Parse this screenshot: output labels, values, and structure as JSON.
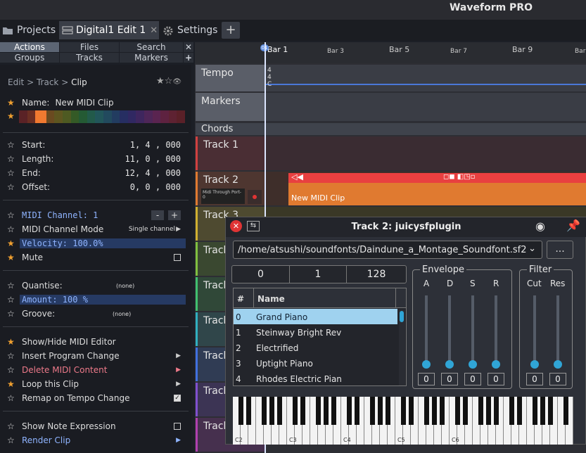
{
  "app": {
    "title": "Waveform PRO"
  },
  "tabs": [
    {
      "label": "Projects"
    },
    {
      "label": "Digital1 Edit 1"
    },
    {
      "label": "Settings"
    }
  ],
  "gridnav": {
    "actions": "Actions",
    "files": "Files",
    "search": "Search",
    "groups": "Groups",
    "tracks": "Tracks",
    "markers": "Markers"
  },
  "breadcrumb": {
    "a": "Edit",
    "b": "Track",
    "c": "Clip",
    "sep": ">"
  },
  "clip": {
    "name_label": "Name:",
    "name_value": "New MIDI Clip",
    "start_label": "Start:",
    "start_value": "1, 4 , 000",
    "length_label": "Length:",
    "length_value": "11, 0 , 000",
    "end_label": "End:",
    "end_value": "12, 4 , 000",
    "offset_label": "Offset:",
    "offset_value": "0, 0 , 000",
    "midi_channel": "MIDI Channel: 1",
    "midi_mode_label": "MIDI Channel Mode",
    "midi_mode_value": "Single channel",
    "velocity": "Velocity: 100.0%",
    "mute": "Mute",
    "quantise_label": "Quantise:",
    "quantise_value": "(none)",
    "amount": "Amount: 100 %",
    "groove_label": "Groove:",
    "groove_value": "(none)",
    "actions": [
      "Show/Hide MIDI Editor",
      "Insert Program Change",
      "Delete MIDI Content",
      "Loop this Clip",
      "Remap on Tempo Change"
    ],
    "show_note_expr": "Show Note Expression",
    "render_clip": "Render Clip"
  },
  "ruler": {
    "bars": [
      "Bar 1",
      "Bar 3",
      "Bar 5",
      "Bar 7",
      "Bar 9",
      "Bar"
    ],
    "marker": "01"
  },
  "tracks": {
    "tempo": "Tempo",
    "markers": "Markers",
    "chords": "Chords",
    "t1": "Track 1",
    "t2": "Track 2",
    "t3": "Track 3",
    "t4": "Track",
    "t5": "Track",
    "t6": "Track",
    "t7": "Track",
    "t8": "Track",
    "t9": "Track",
    "midi_input": "Midi Through Port-0",
    "tempo_ticks": [
      "4",
      "4",
      "C"
    ]
  },
  "midiclip": {
    "label": "New MIDI Clip"
  },
  "plugin": {
    "title": "Track 2: juicysfplugin",
    "path": "/home/atsushi/soundfonts/Daindune_a_Montage_Soundfont.sf2",
    "more": "...",
    "nums": [
      "0",
      "1",
      "128"
    ],
    "list_hash": "#",
    "list_name": "Name",
    "presets": [
      {
        "n": "0",
        "name": "Grand Piano"
      },
      {
        "n": "1",
        "name": "Steinway Bright Rev"
      },
      {
        "n": "2",
        "name": "Electrified"
      },
      {
        "n": "3",
        "name": "Uptight Piano"
      },
      {
        "n": "4",
        "name": "Rhodes Electric Pian"
      }
    ],
    "envelope": {
      "title": "Envelope",
      "labels": [
        "A",
        "D",
        "S",
        "R"
      ],
      "values": [
        "0",
        "0",
        "0",
        "0"
      ]
    },
    "filter": {
      "title": "Filter",
      "labels": [
        "Cut",
        "Res"
      ],
      "values": [
        "0",
        "0"
      ]
    },
    "keys": [
      "C2",
      "C3",
      "C4",
      "C5",
      "C6"
    ]
  },
  "colors": {
    "accent": "#f0a030",
    "record": "#e03434",
    "clip_orange": "#e07a30",
    "clip_red": "#e84040",
    "selection": "#9fd2ef"
  }
}
